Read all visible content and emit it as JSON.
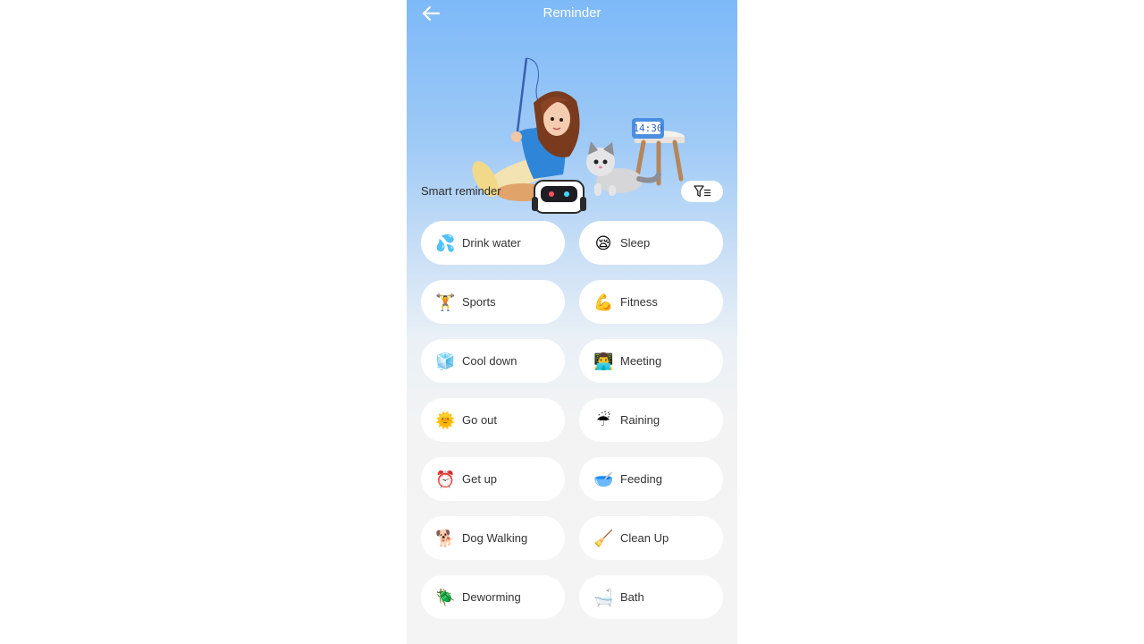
{
  "header": {
    "title": "Reminder",
    "back_icon": "arrow-left-icon"
  },
  "hero": {
    "clock_text": "14:30",
    "illustration": "girl-with-cat-and-robot-illustration"
  },
  "section": {
    "label": "Smart reminder",
    "filter_icon": "filter-icon"
  },
  "reminders": [
    {
      "label": "Drink water",
      "emoji": "💦",
      "icon": "water-drops-icon"
    },
    {
      "label": "Sleep",
      "emoji": "😪",
      "icon": "sleepy-face-icon"
    },
    {
      "label": "Sports",
      "emoji": "🏋️",
      "icon": "weightlifter-icon"
    },
    {
      "label": "Fitness",
      "emoji": "💪",
      "icon": "dumbbell-icon"
    },
    {
      "label": "Cool down",
      "emoji": "🧊",
      "icon": "ice-cube-icon"
    },
    {
      "label": "Meeting",
      "emoji": "👨‍💻",
      "icon": "laptop-person-icon"
    },
    {
      "label": "Go out",
      "emoji": "🌞",
      "icon": "sun-icon"
    },
    {
      "label": "Raining",
      "emoji": "☔",
      "icon": "umbrella-icon"
    },
    {
      "label": "Get up",
      "emoji": "⏰",
      "icon": "alarm-clock-icon"
    },
    {
      "label": "Feeding",
      "emoji": "🥣",
      "icon": "pet-bowl-icon"
    },
    {
      "label": "Dog Walking",
      "emoji": "🐕",
      "icon": "dog-icon"
    },
    {
      "label": "Clean Up",
      "emoji": "🧹",
      "icon": "broom-icon"
    },
    {
      "label": "Deworming",
      "emoji": "🪲",
      "icon": "bug-icon"
    },
    {
      "label": "Bath",
      "emoji": "🛁",
      "icon": "bathtub-icon"
    }
  ]
}
